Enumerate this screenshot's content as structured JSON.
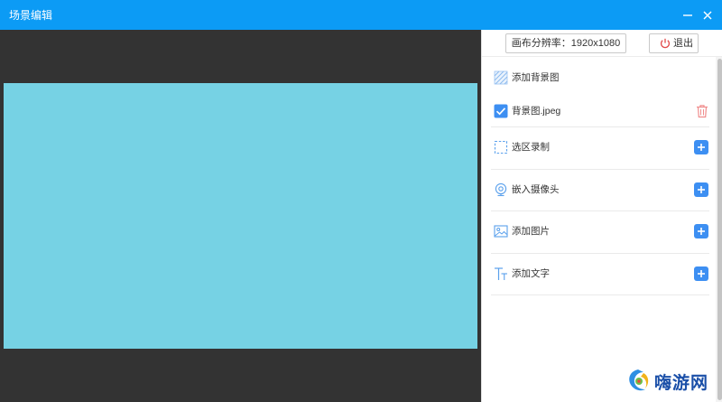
{
  "window": {
    "title": "场景编辑"
  },
  "toolbar": {
    "resolution_label": "画布分辨率：1920x1080",
    "exit_label": "退出"
  },
  "panel": {
    "add_background": "添加背景图",
    "background_item": {
      "label": "背景图.jpeg",
      "checked": true
    },
    "sources": [
      {
        "label": "选区录制",
        "icon": "selection-icon"
      },
      {
        "label": "嵌入摄像头",
        "icon": "camera-icon"
      },
      {
        "label": "添加图片",
        "icon": "image-icon"
      },
      {
        "label": "添加文字",
        "icon": "text-icon"
      }
    ]
  },
  "canvas": {
    "background_color": "#76d2e4"
  },
  "colors": {
    "titlebar": "#0c9bf5",
    "accent": "#3d8ff2",
    "delete": "#f08c8c",
    "canvas_area": "#333333"
  },
  "watermark": {
    "text": "嗨游网"
  }
}
